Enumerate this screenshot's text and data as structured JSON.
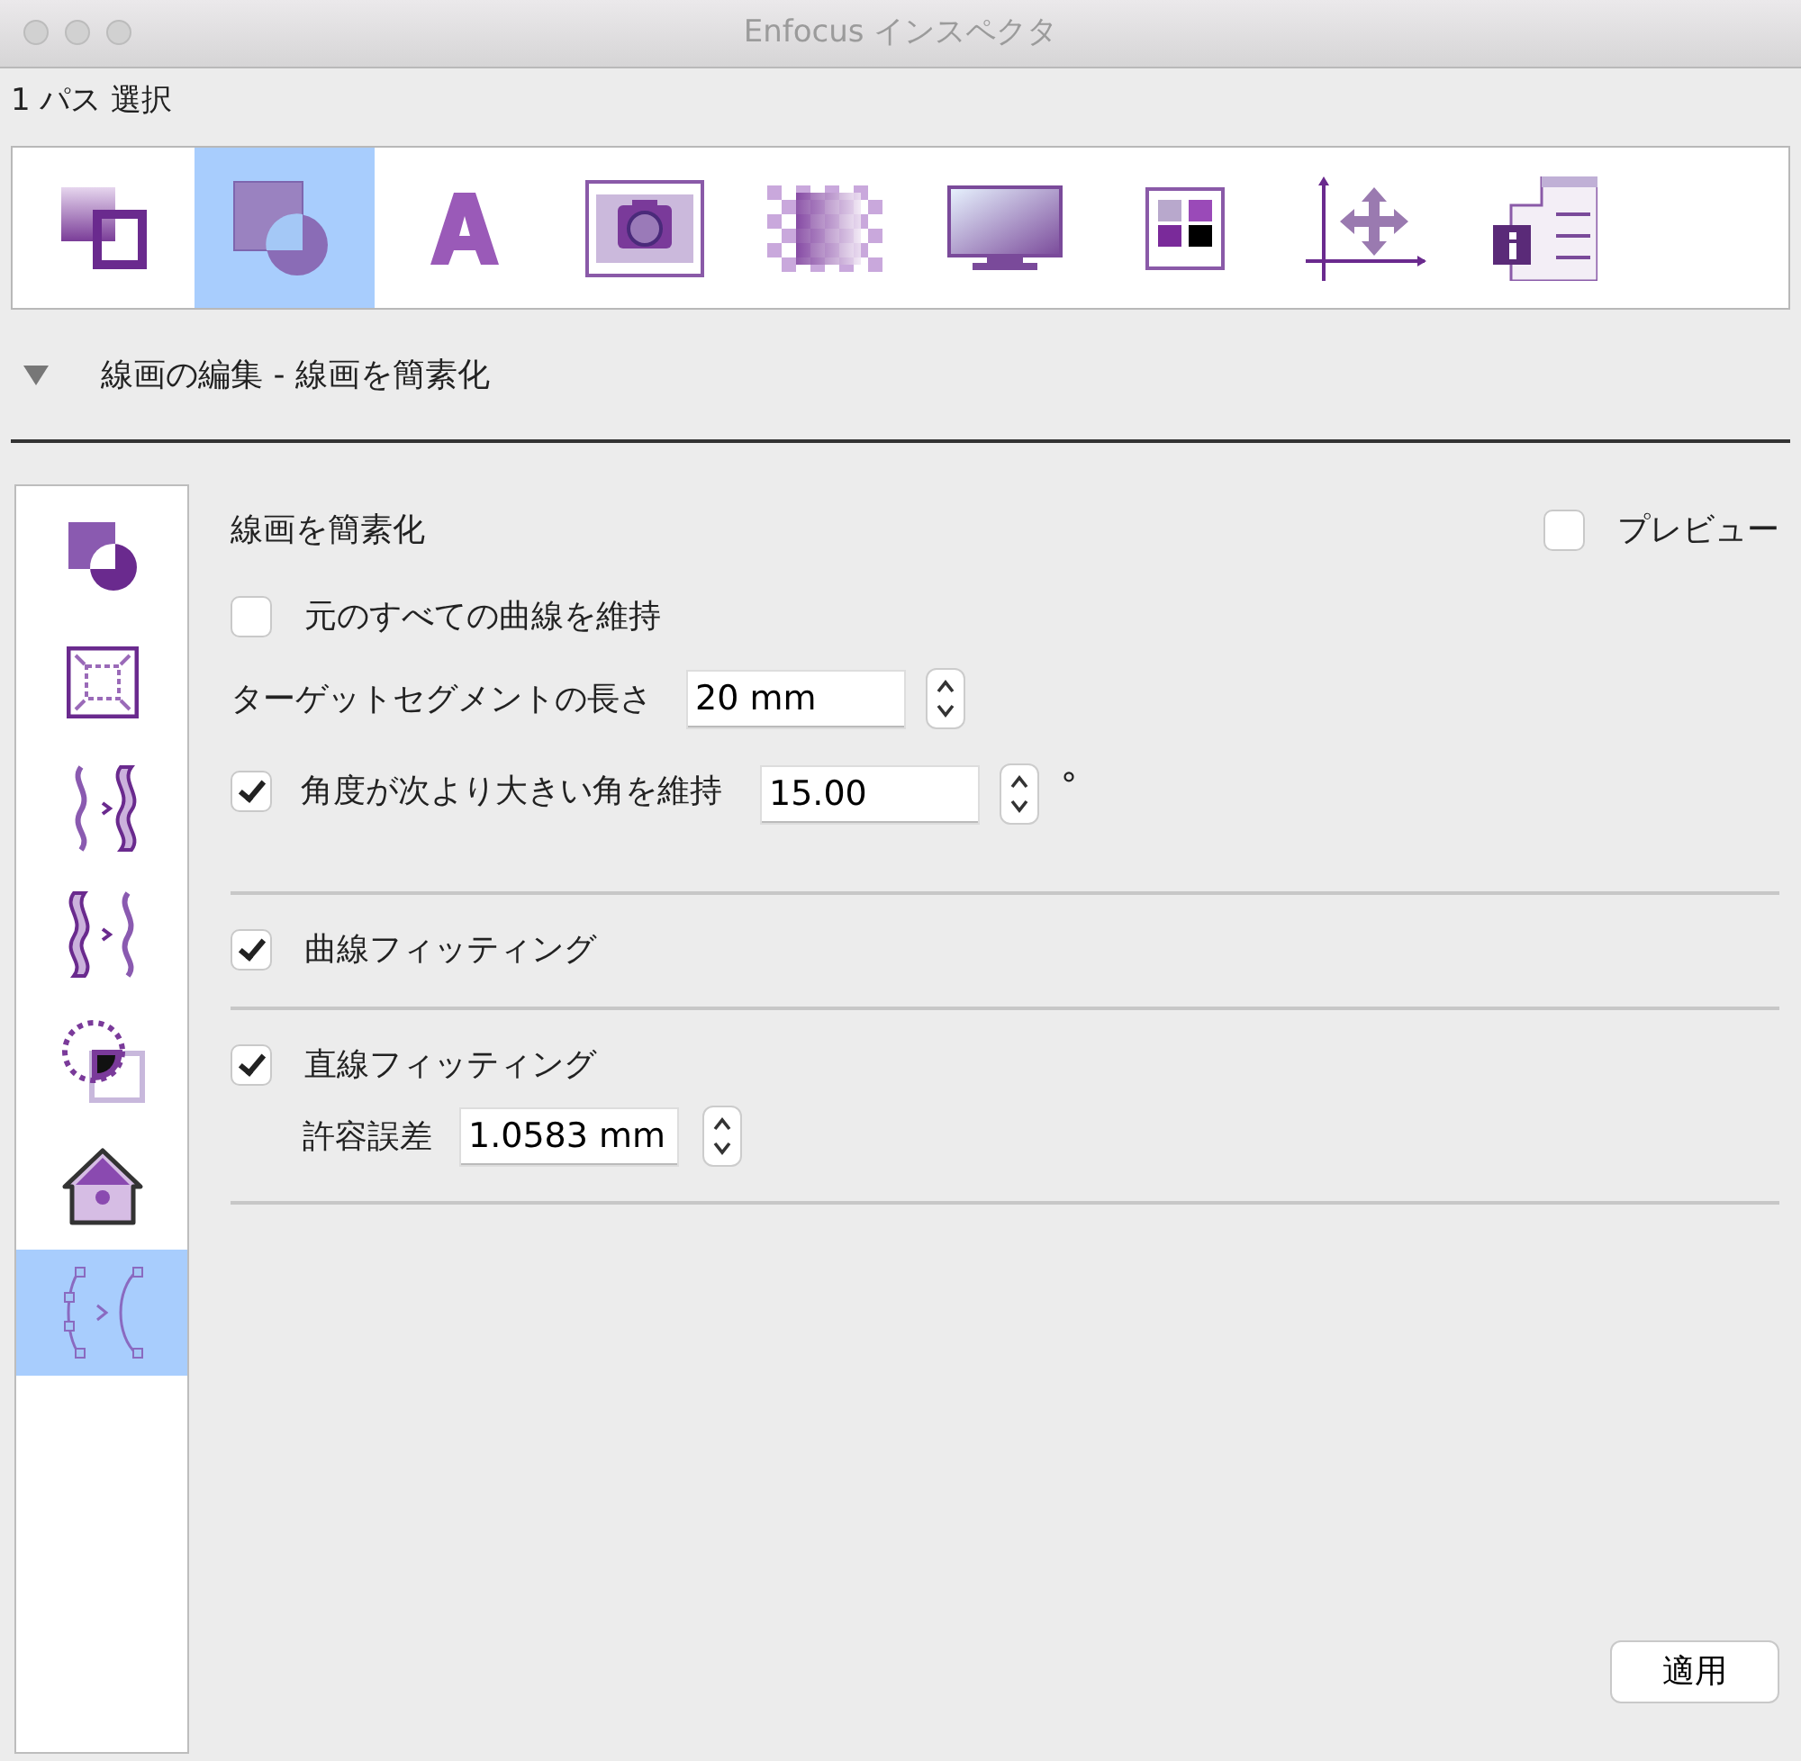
{
  "window": {
    "title": "Enfocus インスペクタ"
  },
  "selection_label": "1 パス 選択",
  "toolbar": [
    {
      "selected": false
    },
    {
      "selected": true
    },
    {
      "selected": false
    },
    {
      "selected": false
    },
    {
      "selected": false
    },
    {
      "selected": false
    },
    {
      "selected": false
    },
    {
      "selected": false
    },
    {
      "selected": false
    }
  ],
  "section": {
    "title": "線画の編集 - 線画を簡素化",
    "expanded": true
  },
  "sidebar": [
    {
      "selected": false
    },
    {
      "selected": false
    },
    {
      "selected": false
    },
    {
      "selected": false
    },
    {
      "selected": false
    },
    {
      "selected": false
    },
    {
      "selected": true
    }
  ],
  "panel": {
    "title": "線画を簡素化",
    "preview": {
      "label": "プレビュー",
      "checked": false
    },
    "groups": [
      [
        {
          "kind": "checkbox",
          "label": "元のすべての曲線を維持",
          "checked": false
        },
        {
          "kind": "stepper",
          "label": "ターゲットセグメントの長さ",
          "value": "20 mm"
        },
        {
          "kind": "checkbox-stepper",
          "label": "角度が次より大きい角を維持",
          "checked": true,
          "value": "15.00",
          "unit": "°"
        }
      ],
      [
        {
          "kind": "checkbox",
          "label": "曲線フィッティング",
          "checked": true
        }
      ],
      [
        {
          "kind": "checkbox",
          "label": "直線フィッティング",
          "checked": true
        },
        {
          "kind": "sub-stepper",
          "label": "許容誤差",
          "value": "1.0583 mm"
        }
      ]
    ]
  },
  "apply_button": "適用"
}
